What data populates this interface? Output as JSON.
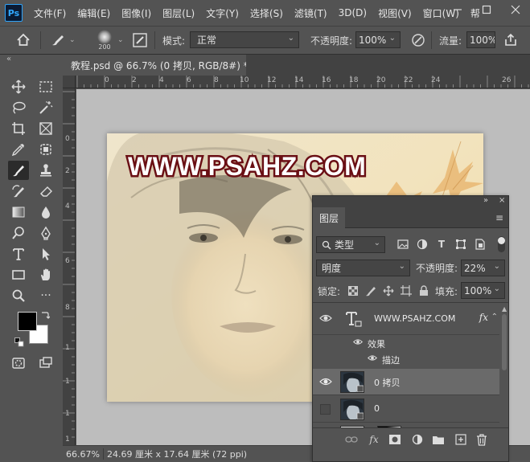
{
  "app": {
    "logo_text": "Ps"
  },
  "menu": [
    "文件(F)",
    "编辑(E)",
    "图像(I)",
    "图层(L)",
    "文字(Y)",
    "选择(S)",
    "滤镜(T)",
    "3D(D)",
    "视图(V)",
    "窗口(W)",
    "帮"
  ],
  "options": {
    "brush_size": "200",
    "mode_label": "模式:",
    "mode_value": "正常",
    "opacity_label": "不透明度:",
    "opacity_value": "100%",
    "flow_label": "流量:",
    "flow_value": "100%"
  },
  "document": {
    "tab_title": "教程.psd @ 66.7% (0 拷贝, RGB/8#) *",
    "canvas_text": "WWW.PSAHZ.COM",
    "ruler_top": [
      "0",
      "2",
      "4",
      "6",
      "8",
      "10",
      "12",
      "14",
      "16",
      "18",
      "20",
      "22",
      "24",
      "26"
    ],
    "ruler_left": [
      "0",
      "2",
      "4",
      "6",
      "8",
      "1",
      "1",
      "1",
      "1"
    ]
  },
  "status": {
    "zoom": "66.67%",
    "info": "24.69 厘米 x 17.64 厘米 (72 ppi)"
  },
  "layers_panel": {
    "tab": "图层",
    "filter_kind": "类型",
    "blend_mode": "明度",
    "opacity_label": "不透明度:",
    "opacity_value": "22%",
    "lock_label": "锁定:",
    "fill_label": "填充:",
    "fill_value": "100%",
    "layers": [
      {
        "name": "WWW.PSAHZ.COM",
        "kind": "text",
        "visible": true,
        "fx": "fx"
      },
      {
        "name": "效果",
        "kind": "effects-group"
      },
      {
        "name": "描边",
        "kind": "effect"
      },
      {
        "name": "0 拷贝",
        "kind": "pixel",
        "visible": true,
        "selected": true
      },
      {
        "name": "0",
        "kind": "pixel",
        "visible": false
      }
    ]
  },
  "colors": {
    "foreground": "#000000",
    "background": "#ffffff",
    "ui_bg": "#535353",
    "accent": "#31a8ff"
  }
}
